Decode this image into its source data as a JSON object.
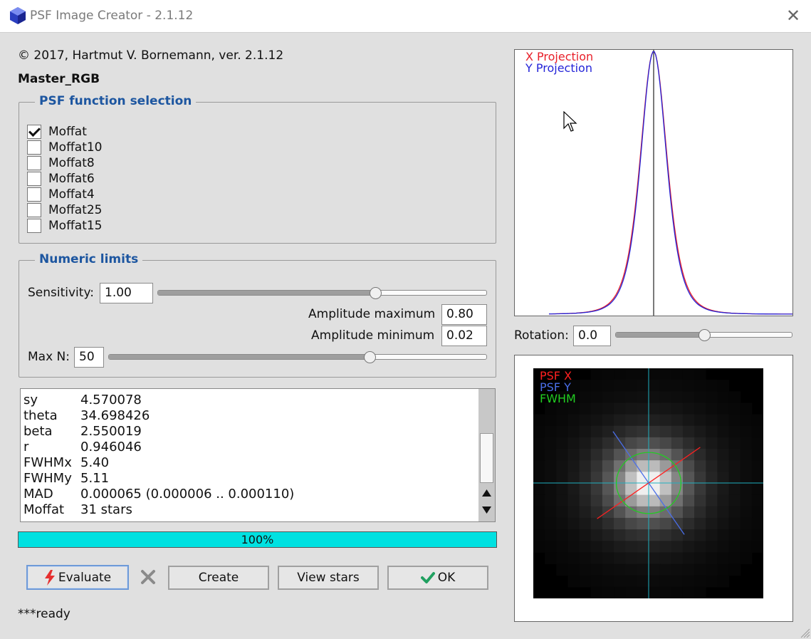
{
  "window": {
    "title": "PSF Image Creator - 2.1.12",
    "close_glyph": "✕"
  },
  "header": {
    "copyright": "© 2017, Hartmut V. Bornemann, ver. 2.1.12",
    "image_name": "Master_RGB"
  },
  "psf_group": {
    "title": "PSF function selection",
    "options": [
      {
        "label": "Moffat",
        "checked": true
      },
      {
        "label": "Moffat10",
        "checked": false
      },
      {
        "label": "Moffat8",
        "checked": false
      },
      {
        "label": "Moffat6",
        "checked": false
      },
      {
        "label": "Moffat4",
        "checked": false
      },
      {
        "label": "Moffat25",
        "checked": false
      },
      {
        "label": "Moffat15",
        "checked": false
      }
    ]
  },
  "limits_group": {
    "title": "Numeric limits",
    "sensitivity_label": "Sensitivity:",
    "sensitivity_value": "1.00",
    "sensitivity_slider_fraction": 0.66,
    "amp_max_label": "Amplitude maximum",
    "amp_max_value": "0.80",
    "amp_min_label": "Amplitude minimum",
    "amp_min_value": "0.02",
    "maxn_label": "Max N:",
    "maxn_value": "50",
    "maxn_slider_fraction": 0.69
  },
  "results": {
    "rows": [
      {
        "key": "sy",
        "value": "4.570078"
      },
      {
        "key": "theta",
        "value": "34.698426"
      },
      {
        "key": "beta",
        "value": "2.550019"
      },
      {
        "key": "r",
        "value": "0.946046"
      },
      {
        "key": "FWHMx",
        "value": "5.40"
      },
      {
        "key": "FWHMy",
        "value": "5.11"
      },
      {
        "key": "MAD",
        "value": "0.000065 (0.000006 .. 0.000110)"
      },
      {
        "key": "Moffat",
        "value": "31 stars"
      }
    ]
  },
  "progress": {
    "text": "100%",
    "fraction": 1.0
  },
  "buttons": {
    "evaluate": "Evaluate",
    "create": "Create",
    "view_stars": "View stars",
    "ok": "OK"
  },
  "status": "***ready",
  "projection_plot": {
    "legend_x": "X Projection",
    "legend_y": "Y Projection",
    "color_x": "#e8202a",
    "color_y": "#2424d8"
  },
  "rotation": {
    "label": "Rotation:",
    "value": "0.0",
    "slider_fraction": 0.5
  },
  "psf_image": {
    "legend_x": "PSF X",
    "legend_y": "PSF Y",
    "legend_fwhm": "FWHM",
    "color_x": "#ff2020",
    "color_y": "#4a6ee8",
    "color_fwhm": "#22cc22",
    "theta_deg": 34.698426,
    "fwhm_x": 5.4,
    "fwhm_y": 5.11
  },
  "colors": {
    "group_title": "#1d56a0",
    "progress": "#00e1e1",
    "evaluate_icon": "#e63030",
    "ok_icon": "#20a060"
  },
  "icons": {
    "app": "blue-gem-icon",
    "evaluate": "lightning-icon",
    "cancel": "x-icon",
    "ok": "checkmark-icon"
  }
}
